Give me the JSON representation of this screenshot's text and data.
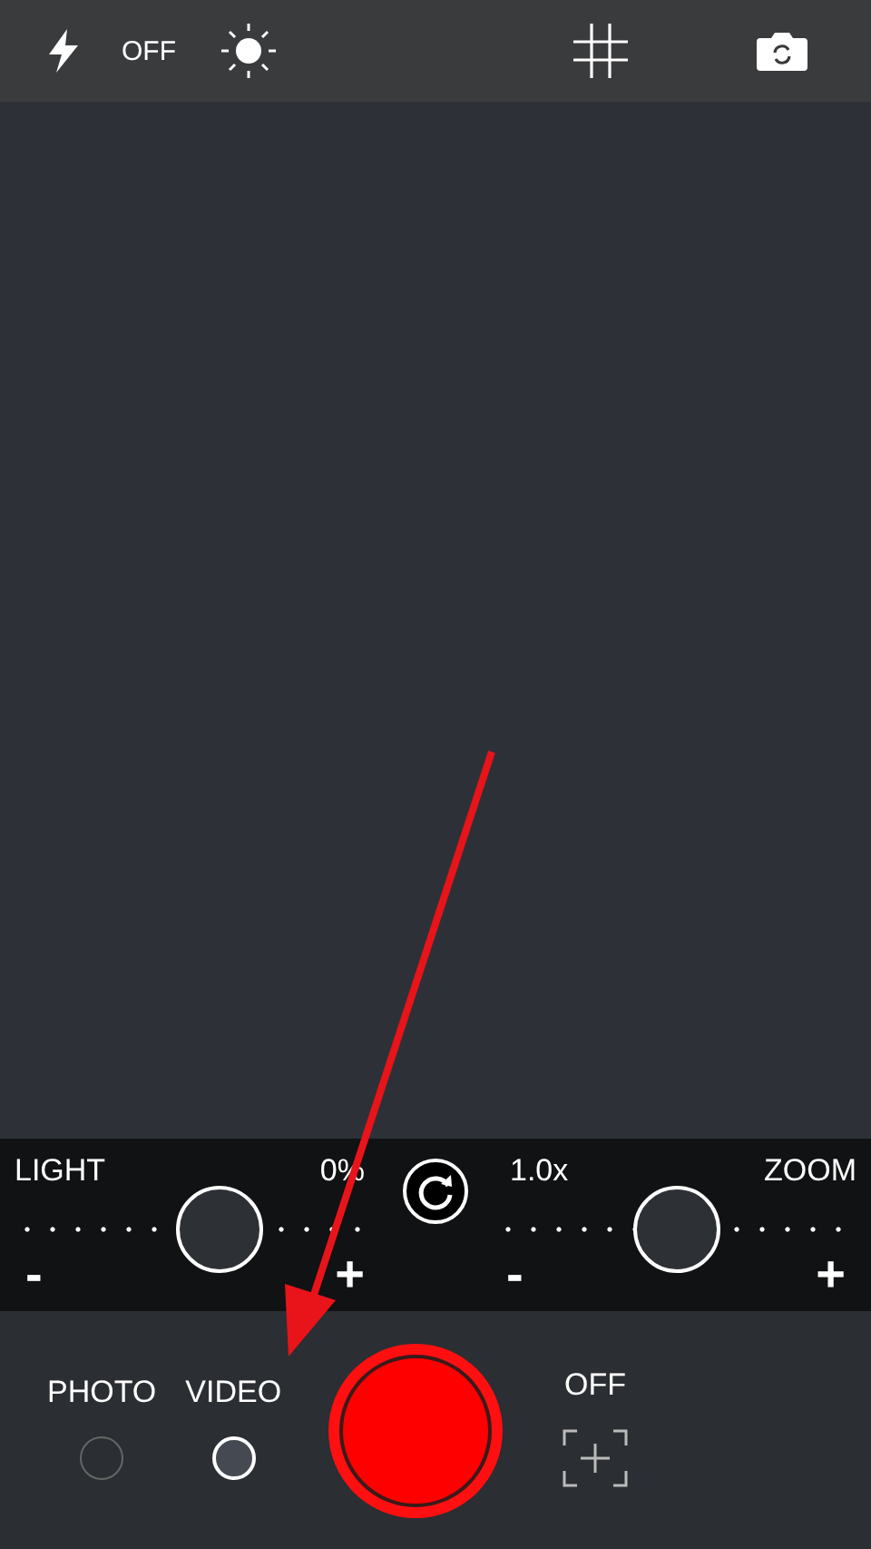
{
  "top_bar": {
    "flash": {
      "label": "OFF"
    }
  },
  "sliders": [
    {
      "label": "LIGHT",
      "reading": "0%",
      "level": 0.57,
      "minus": "-",
      "plus": "+"
    },
    {
      "label": "ZOOM",
      "reading": "1.0x",
      "level": 0.5,
      "minus": "-",
      "plus": "+"
    }
  ],
  "modes": [
    {
      "label": "PHOTO",
      "selected": false
    },
    {
      "label": "VIDEO",
      "selected": true
    }
  ],
  "timer": {
    "label": "OFF"
  }
}
